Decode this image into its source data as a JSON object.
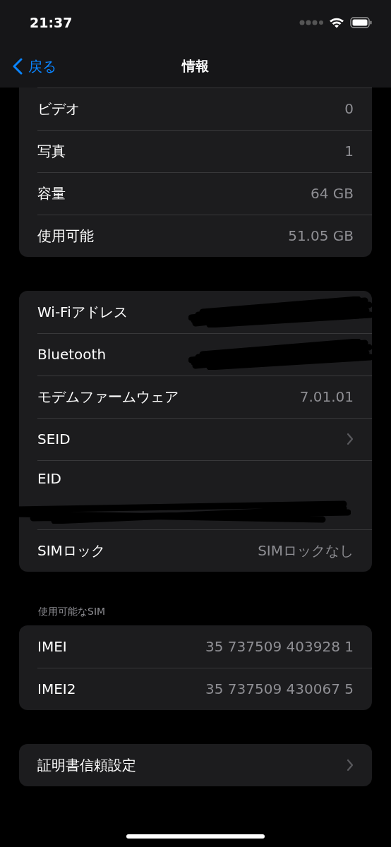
{
  "status_bar": {
    "time": "21:37"
  },
  "nav": {
    "back": "戻る",
    "title": "情報"
  },
  "groups": [
    {
      "rows": [
        {
          "kind": "value",
          "label": "ビデオ",
          "value": "0"
        },
        {
          "kind": "value",
          "label": "写真",
          "value": "1"
        },
        {
          "kind": "value",
          "label": "容量",
          "value": "64 GB"
        },
        {
          "kind": "value",
          "label": "使用可能",
          "value": "51.05 GB"
        }
      ]
    },
    {
      "rows": [
        {
          "kind": "redacted",
          "label": "Wi-Fiアドレス"
        },
        {
          "kind": "redacted",
          "label": "Bluetooth"
        },
        {
          "kind": "value",
          "label": "モデムファームウェア",
          "value": "7.01.01"
        },
        {
          "kind": "link",
          "label": "SEID"
        },
        {
          "kind": "redacted_tall",
          "label": "EID"
        },
        {
          "kind": "value",
          "label": "SIMロック",
          "value": "SIMロックなし"
        }
      ]
    },
    {
      "header": "使用可能なSIM",
      "rows": [
        {
          "kind": "value",
          "label": "IMEI",
          "value": "35 737509 403928 1"
        },
        {
          "kind": "value",
          "label": "IMEI2",
          "value": "35 737509 430067 5"
        }
      ]
    },
    {
      "rows": [
        {
          "kind": "link",
          "label": "証明書信頼設定"
        }
      ]
    }
  ]
}
